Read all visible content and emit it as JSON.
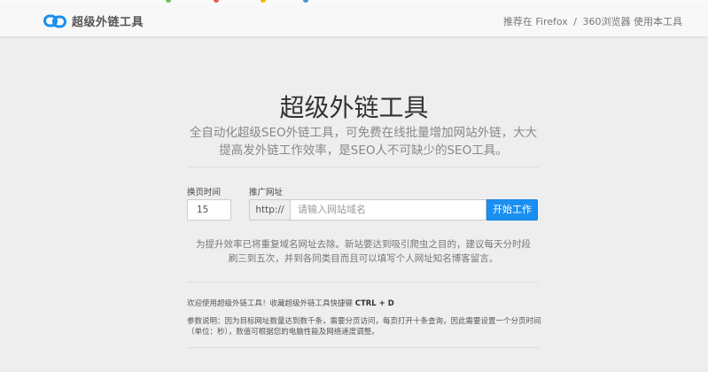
{
  "navbar": {
    "logo_text": "超级外链工具",
    "recommend_prefix": "推荐在",
    "firefox": "Firefox",
    "separator": "/",
    "browser360": "360浏览器",
    "recommend_suffix": "使用本工具"
  },
  "hero": {
    "title": "超级外链工具",
    "subtitle": "全自动化超级SEO外链工具，可免费在线批量增加网站外链，大大提高发外链工作效率，是SEO人不可缺少的SEO工具。"
  },
  "form": {
    "page_time_label": "换页时间",
    "page_time_value": "15",
    "promo_url_label": "推广网址",
    "url_prefix": "http://",
    "url_placeholder": "请输入网站域名",
    "start_button": "开始工作"
  },
  "notice": "为提升效率已将重复域名网址去除。新站要达到吸引爬虫之目的，建议每天分时段刷三到五次，并到各同类目而且可以填写个人网址知名博客留言。",
  "footer": {
    "welcome_text": "欢迎使用超级外链工具！收藏超级外链工具快捷键",
    "shortcut": "CTRL + D",
    "param_text": "参数说明：因为目标网址数量达到数千条，需要分页访问，每页打开十条查询，因此需要设置一个分页时间（单位：秒），数值可根据您的电脑性能及网络速度调整。"
  },
  "colors": {
    "accent": "#1a8ff2",
    "logo": "#1a8ff2",
    "background": "#eeeeee"
  },
  "icons": {
    "logo": "chain-link-icon"
  }
}
